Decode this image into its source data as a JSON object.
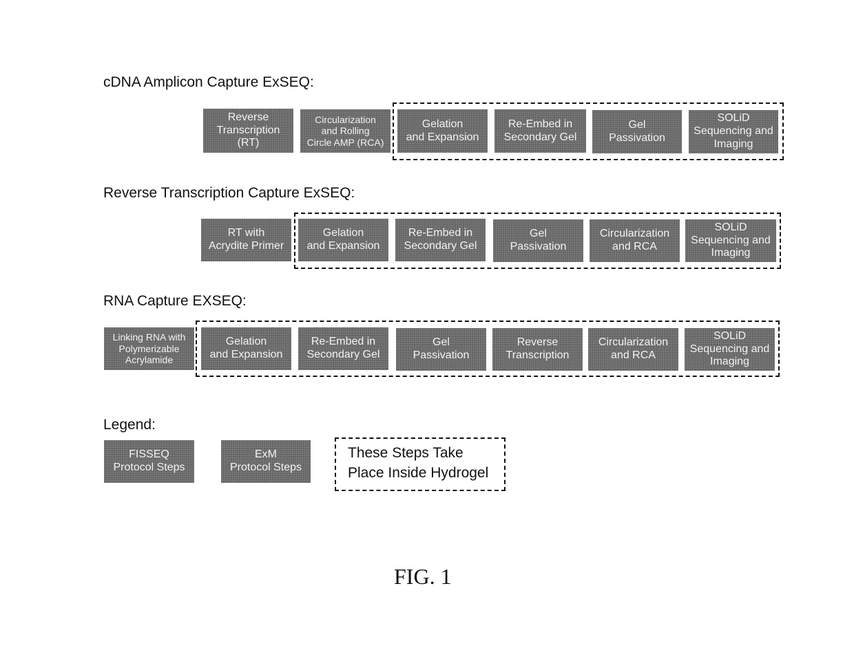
{
  "diagram": {
    "rows": [
      {
        "title": "cDNA Amplicon Capture ExSEQ:",
        "steps": [
          {
            "label": "Reverse\nTranscription\n(RT)",
            "type": "FISSEQ"
          },
          {
            "label": "Circularization\nand Rolling\nCircle AMP (RCA)",
            "type": "FISSEQ"
          },
          {
            "label": "Gelation\nand Expansion",
            "type": "ExM",
            "inside_hydrogel": true
          },
          {
            "label": "Re-Embed in\nSecondary Gel",
            "type": "ExM",
            "inside_hydrogel": true
          },
          {
            "label": "Gel\nPassivation",
            "type": "ExM",
            "inside_hydrogel": true
          },
          {
            "label": "SOLiD\nSequencing and\nImaging",
            "type": "FISSEQ",
            "inside_hydrogel": true
          }
        ]
      },
      {
        "title": "Reverse Transcription Capture ExSEQ:",
        "steps": [
          {
            "label": "RT with\nAcrydite Primer",
            "type": "FISSEQ"
          },
          {
            "label": "Gelation\nand Expansion",
            "type": "ExM",
            "inside_hydrogel": true
          },
          {
            "label": "Re-Embed in\nSecondary Gel",
            "type": "ExM",
            "inside_hydrogel": true
          },
          {
            "label": "Gel\nPassivation",
            "type": "ExM",
            "inside_hydrogel": true
          },
          {
            "label": "Circularization\nand RCA",
            "type": "FISSEQ",
            "inside_hydrogel": true
          },
          {
            "label": "SOLiD\nSequencing and\nImaging",
            "type": "FISSEQ",
            "inside_hydrogel": true
          }
        ]
      },
      {
        "title": "RNA Capture EXSEQ:",
        "steps": [
          {
            "label": "Linking RNA with\nPolymerizable\nAcrylamide",
            "type": "ExM"
          },
          {
            "label": "Gelation\nand Expansion",
            "type": "ExM",
            "inside_hydrogel": true
          },
          {
            "label": "Re-Embed in\nSecondary Gel",
            "type": "ExM",
            "inside_hydrogel": true
          },
          {
            "label": "Gel\nPassivation",
            "type": "ExM",
            "inside_hydrogel": true
          },
          {
            "label": "Reverse\nTranscription",
            "type": "FISSEQ",
            "inside_hydrogel": true
          },
          {
            "label": "Circularization\nand RCA",
            "type": "FISSEQ",
            "inside_hydrogel": true
          },
          {
            "label": "SOLiD\nSequencing and\nImaging",
            "type": "FISSEQ",
            "inside_hydrogel": true
          }
        ]
      }
    ],
    "legend": {
      "title": "Legend:",
      "items": [
        {
          "label": "FISSEQ\nProtocol Steps"
        },
        {
          "label": "ExM\nProtocol Steps"
        },
        {
          "label": "These Steps Take\nPlace Inside Hydrogel"
        }
      ]
    },
    "caption": "FIG. 1"
  }
}
